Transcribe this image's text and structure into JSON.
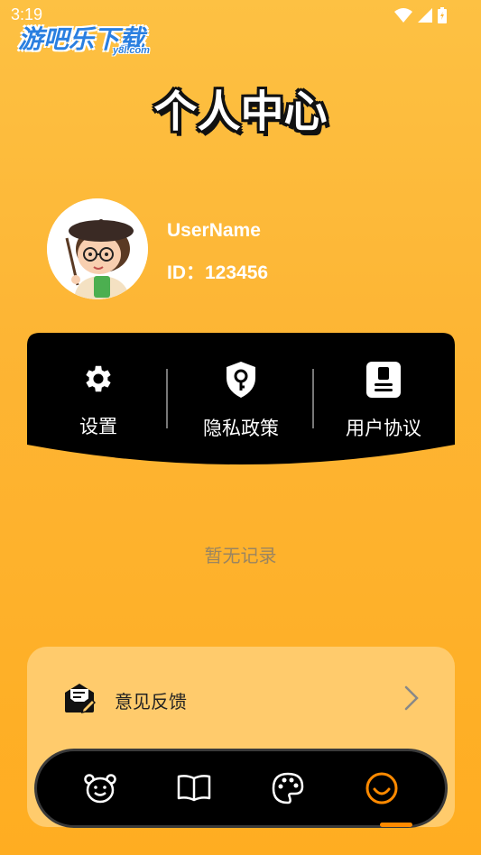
{
  "status_bar": {
    "time": "3:19"
  },
  "watermark": {
    "title": "游吧乐下载",
    "subtitle": "y8l.com"
  },
  "page": {
    "title": "个人中心"
  },
  "profile": {
    "username": "UserName",
    "id_text": "ID：123456"
  },
  "menu": {
    "items": [
      {
        "label": "设置",
        "icon": "gear-icon"
      },
      {
        "label": "隐私政策",
        "icon": "shield-key-icon"
      },
      {
        "label": "用户协议",
        "icon": "contact-card-icon"
      }
    ]
  },
  "empty_state": {
    "text": "暂无记录"
  },
  "feedback": {
    "label": "意见反馈",
    "icon": "mail-edit-icon"
  },
  "tabs": [
    {
      "name": "bear-icon",
      "active": false
    },
    {
      "name": "book-icon",
      "active": false
    },
    {
      "name": "palette-icon",
      "active": false
    },
    {
      "name": "smile-icon",
      "active": true
    }
  ],
  "colors": {
    "background_top": "#fdc143",
    "background_bottom": "#ffad21",
    "accent": "#ff8a00",
    "card": "#ffcb6c"
  }
}
